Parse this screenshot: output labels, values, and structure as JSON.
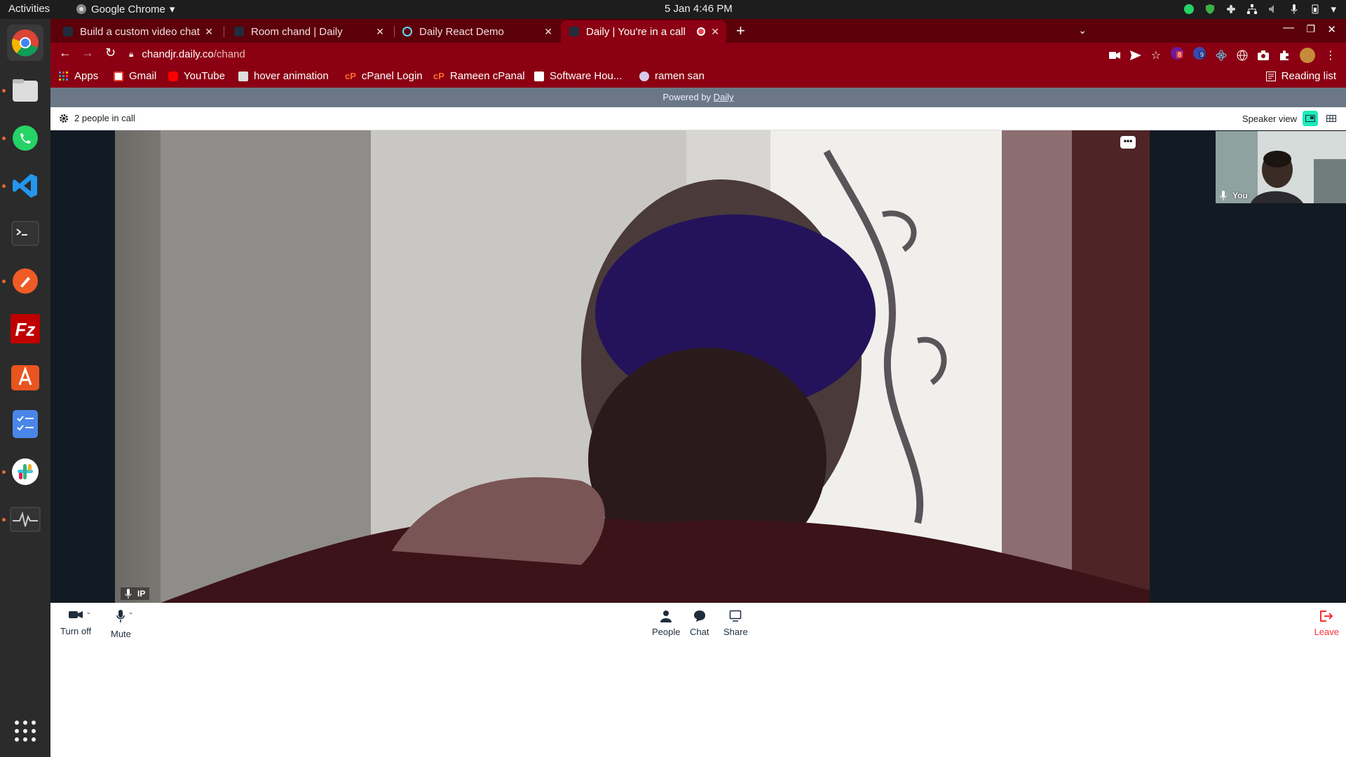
{
  "system_bar": {
    "activities": "Activities",
    "app_name": "Google Chrome",
    "clock": "5 Jan  4:46 PM"
  },
  "tabs": [
    {
      "title": "Build a custom video chat",
      "active": false
    },
    {
      "title": "Room chand | Daily",
      "active": false
    },
    {
      "title": "Daily React Demo",
      "active": false
    },
    {
      "title": "Daily | You're in a call",
      "active": true
    }
  ],
  "address": {
    "host": "chandjr.daily.co",
    "path": "/chand"
  },
  "extension_badges": {
    "ext1": "8",
    "ext2": "9"
  },
  "bookmarks": {
    "apps": "Apps",
    "items": [
      "Gmail",
      "YouTube",
      "hover animation",
      "cPanel Login",
      "Rameen cPanal",
      "Software Hou...",
      "ramen san"
    ],
    "reading_list": "Reading list"
  },
  "daily": {
    "powered_prefix": "Powered by ",
    "powered_link": "Daily",
    "people_count": "2 people in call",
    "speaker_view": "Speaker view",
    "main_participant": "IP",
    "self_label": "You",
    "controls": {
      "camera": "Turn off",
      "mute": "Mute",
      "people": "People",
      "chat": "Chat",
      "share": "Share",
      "leave": "Leave"
    }
  },
  "colors": {
    "chrome_tabstrip": "#5c0009",
    "chrome_toolbar": "#8b0012",
    "daily_powered_bar": "#6b7787",
    "speaker_view_active": "#1bebb9",
    "leave_red": "#f63135"
  }
}
